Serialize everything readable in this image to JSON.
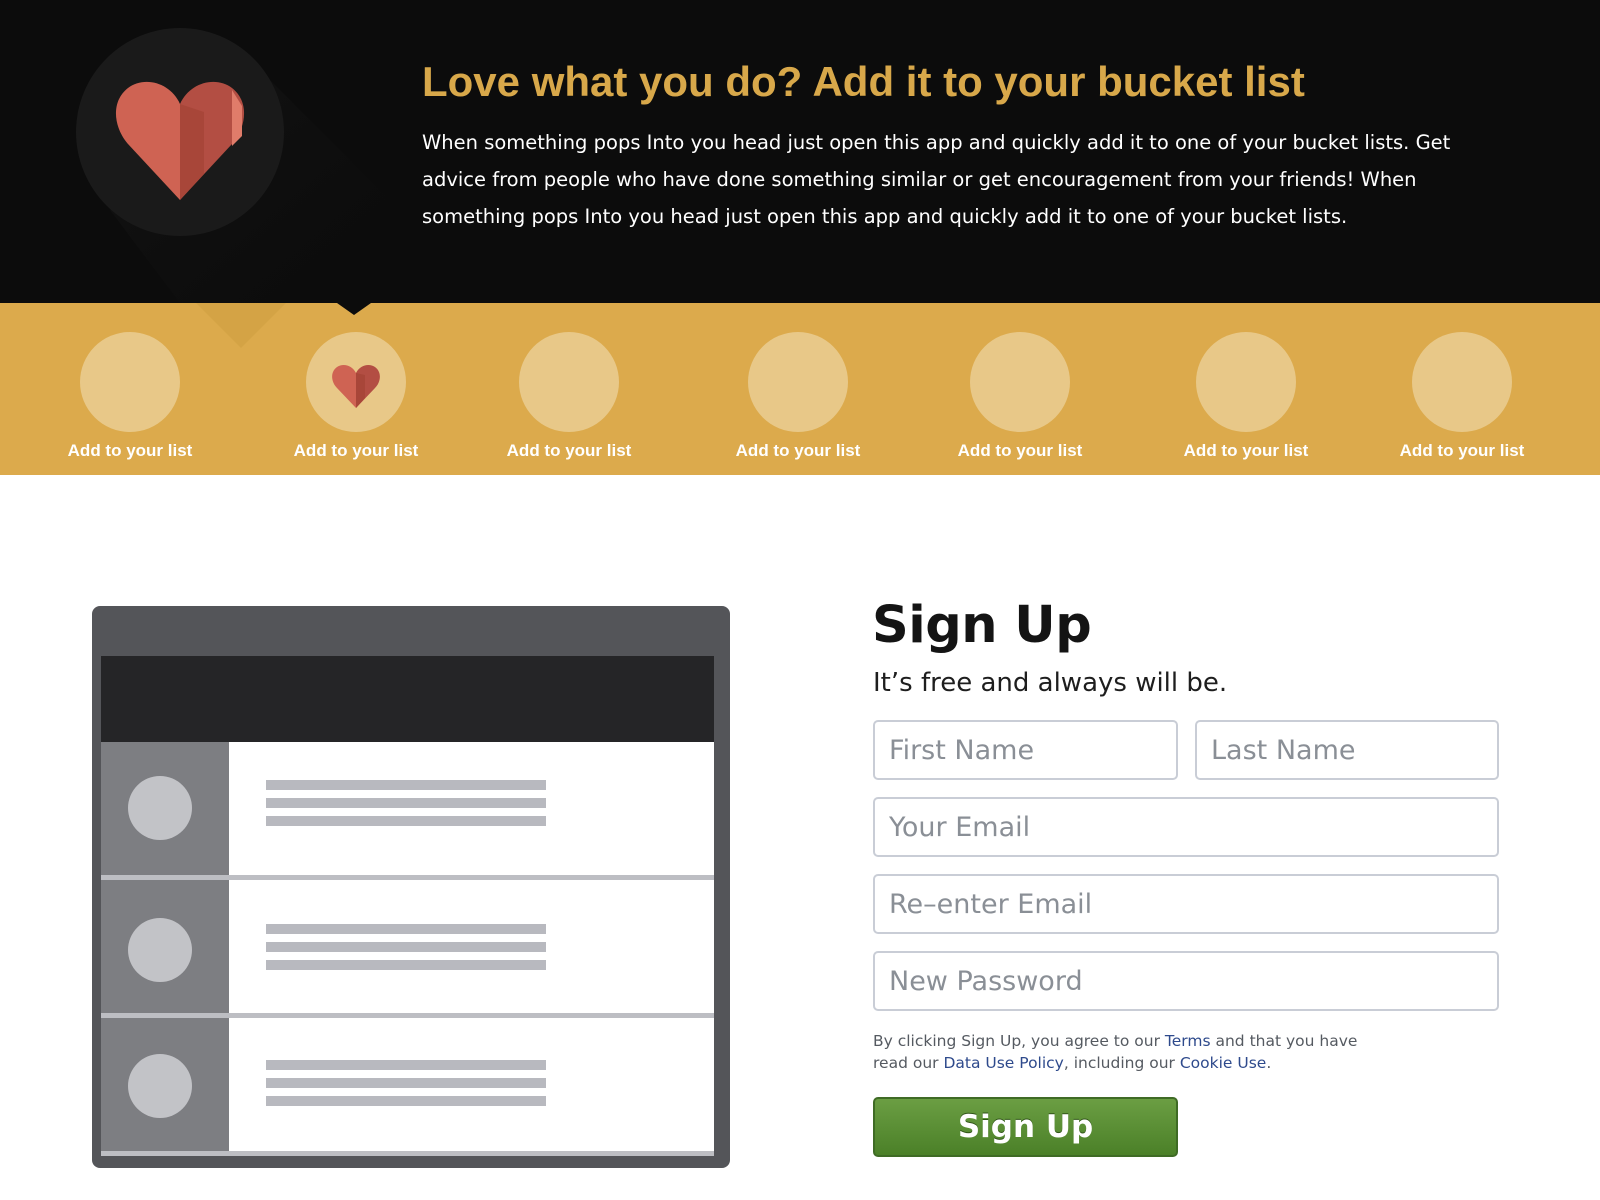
{
  "hero": {
    "title_light": "Love what you do?",
    "title_bold": "Add it to your bucket list",
    "description": "When something pops Into you head just open this app and quickly add it to one of your bucket lists. Get advice from people who have done something similar or get encouragement from your friends! When something pops Into you head just open this app and quickly add it to one of your bucket lists.",
    "icon": "heart-icon"
  },
  "categories": [
    {
      "label": "Add to your list",
      "icon": ""
    },
    {
      "label": "Add to your list",
      "icon": "heart-icon",
      "selected": true
    },
    {
      "label": "Add to your list",
      "icon": ""
    },
    {
      "label": "Add to your list",
      "icon": ""
    },
    {
      "label": "Add to your list",
      "icon": ""
    },
    {
      "label": "Add to your list",
      "icon": ""
    },
    {
      "label": "Add to your list",
      "icon": ""
    }
  ],
  "signup": {
    "title": "Sign Up",
    "subtitle": "It’s free and always will be.",
    "first_name_placeholder": "First Name",
    "last_name_placeholder": "Last Name",
    "email_placeholder": "Your Email",
    "reenter_email_placeholder": "Re–enter Email",
    "password_placeholder": "New Password",
    "terms": {
      "prefix": "By clicking Sign Up, you agree to our ",
      "terms_link": "Terms",
      "middle1": " and that you have read our ",
      "data_policy_link": "Data Use Policy",
      "middle2": ", including our ",
      "cookie_link": "Cookie Use",
      "suffix": "."
    },
    "button_label": "Sign Up"
  },
  "colors": {
    "hero_bg": "#0c0c0c",
    "accent_gold": "#dcaa4c",
    "title_gold": "#d8a84a",
    "heart_red": "#c95a4e",
    "button_green": "#5b8f35",
    "link_blue": "#2e4a8c"
  }
}
